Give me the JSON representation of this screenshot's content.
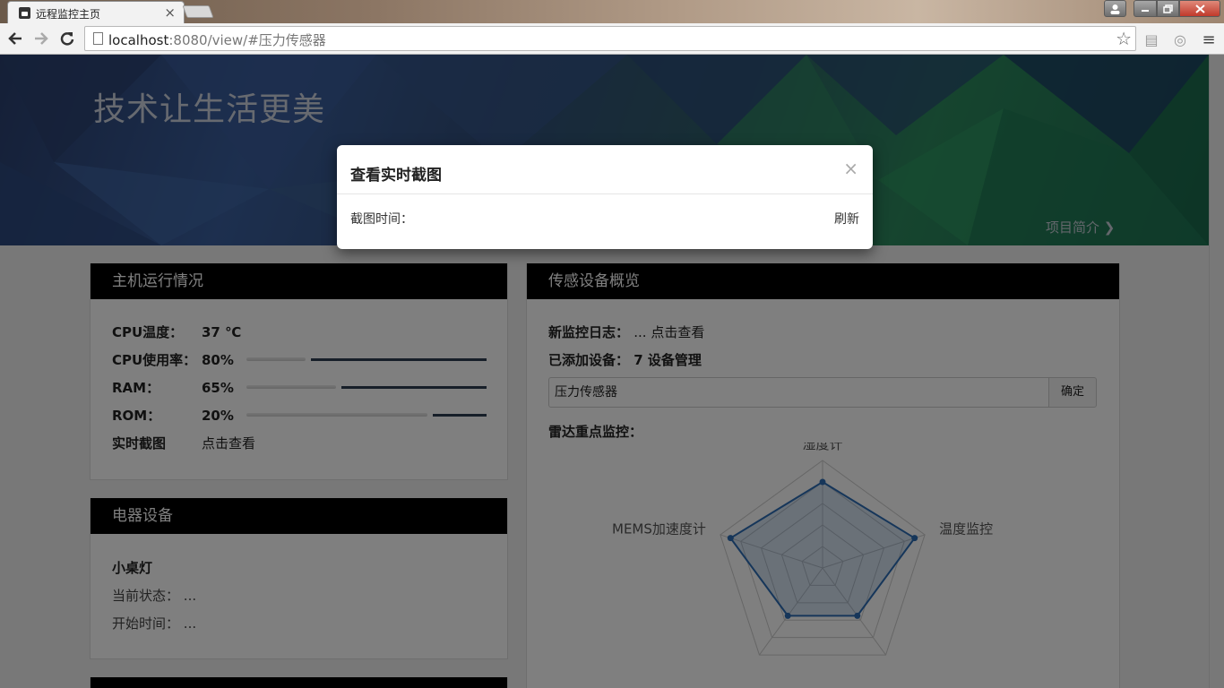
{
  "browser": {
    "tab_title": "远程监控主页",
    "tab_close": "×",
    "url_host": "localhost",
    "url_rest": ":8080/view/#压力传感器"
  },
  "hero": {
    "title": "技术让生活更美",
    "link": "项目简介 ❯"
  },
  "host_panel": {
    "title": "主机运行情况",
    "cpu_temp": {
      "label": "CPU温度：",
      "value": "37 ℃"
    },
    "cpu_usage": {
      "label": "CPU使用率：",
      "value": "80%",
      "level": 0.8
    },
    "ram": {
      "label": "RAM：",
      "value": "65%",
      "level": 0.65
    },
    "rom": {
      "label": "ROM：",
      "value": "20%",
      "level": 0.2
    },
    "screenshot": {
      "label": "实时截图",
      "value": "点击查看"
    }
  },
  "appliance_panel": {
    "title": "电器设备",
    "device": "小桌灯",
    "status_label": "当前状态：",
    "status_value": "...",
    "start_label": "开始时间：",
    "start_value": "..."
  },
  "sensor_panel": {
    "title": "传感设备概览",
    "log_label": "新监控日志：",
    "log_value": "... 点击查看",
    "added_label": "已添加设备：",
    "added_value": "7 设备管理",
    "input_value": "压力传感器",
    "confirm_label": "确定",
    "radar_label": "雷达重点监控："
  },
  "radar": {
    "indicators": [
      "湿度计",
      "温度监控",
      "",
      "",
      "MEMS加速度计"
    ],
    "values": [
      0.8,
      0.9,
      0.55,
      0.55,
      0.9
    ],
    "color": "#2d6db5"
  },
  "modal": {
    "title": "查看实时截图",
    "close": "×",
    "time_label": "截图时间：",
    "refresh": "刷新"
  }
}
